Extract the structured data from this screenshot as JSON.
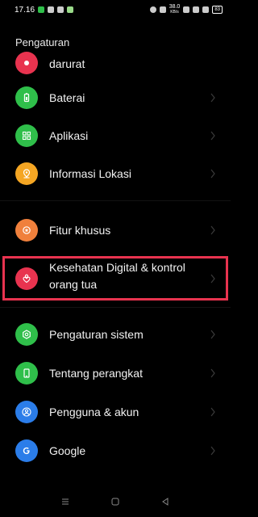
{
  "status": {
    "time": "17.16",
    "speed": "38.0",
    "speed_unit": "KB/s",
    "battery": "83"
  },
  "header": {
    "title": "Pengaturan"
  },
  "items": [
    {
      "label": "darurat",
      "icon": "emergency-icon",
      "color": "#e8334f"
    },
    {
      "label": "Baterai",
      "icon": "battery-icon",
      "color": "#2fbf4a"
    },
    {
      "label": "Aplikasi",
      "icon": "apps-grid-icon",
      "color": "#2fbf4a"
    },
    {
      "label": "Informasi Lokasi",
      "icon": "location-icon",
      "color": "#f5a623"
    },
    {
      "label": "Fitur khusus",
      "icon": "special-features-icon",
      "color": "#f0803c"
    },
    {
      "label_line1": "Kesehatan Digital & kontrol",
      "label_line2": "orang tua",
      "icon": "digital-wellbeing-icon",
      "color": "#e8334f"
    },
    {
      "label": "Pengaturan sistem",
      "icon": "system-settings-icon",
      "color": "#2fbf4a"
    },
    {
      "label": "Tentang perangkat",
      "icon": "phone-info-icon",
      "color": "#2fbf4a"
    },
    {
      "label": "Pengguna & akun",
      "icon": "user-account-icon",
      "color": "#2b7de9"
    },
    {
      "label": "Google",
      "icon": "google-icon",
      "color": "#2b7de9"
    }
  ]
}
